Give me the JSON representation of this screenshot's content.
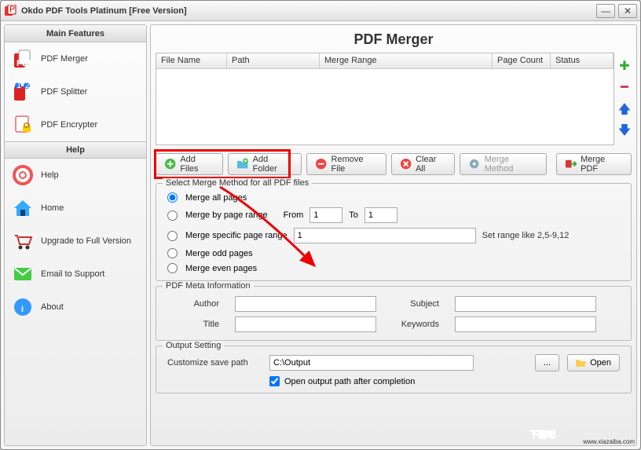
{
  "window": {
    "title": "Okdo PDF Tools Platinum [Free Version]"
  },
  "sidebar": {
    "mainFeaturesHeader": "Main Features",
    "helpHeader": "Help",
    "features": [
      {
        "label": "PDF Merger"
      },
      {
        "label": "PDF Splitter"
      },
      {
        "label": "PDF Encrypter"
      }
    ],
    "helpItems": [
      {
        "label": "Help"
      },
      {
        "label": "Home"
      },
      {
        "label": "Upgrade to Full Version"
      },
      {
        "label": "Email to Support"
      },
      {
        "label": "About"
      }
    ]
  },
  "page": {
    "title": "PDF Merger"
  },
  "fileTable": {
    "columns": [
      "File Name",
      "Path",
      "Merge Range",
      "Page Count",
      "Status"
    ],
    "rows": []
  },
  "toolbar": {
    "addFiles": "Add Files",
    "addFolder": "Add Folder",
    "removeFile": "Remove File",
    "clearAll": "Clear All",
    "mergeMethod": "Merge Method",
    "mergePdf": "Merge PDF"
  },
  "mergeMethod": {
    "title": "Select Merge Method for all PDF files",
    "all": "Merge all pages",
    "byRange": "Merge by page range",
    "fromLabel": "From",
    "toLabel": "To",
    "fromValue": "1",
    "toValue": "1",
    "specific": "Merge specific page range",
    "specificValue": "1",
    "hint": "Set range like 2,5-9,12",
    "odd": "Merge odd pages",
    "even": "Merge even pages"
  },
  "meta": {
    "title": "PDF Meta Information",
    "authorLabel": "Author",
    "authorValue": "",
    "subjectLabel": "Subject",
    "subjectValue": "",
    "titleLabel": "Title",
    "titleValue": "",
    "keywordsLabel": "Keywords",
    "keywordsValue": ""
  },
  "output": {
    "title": "Output Setting",
    "customizeLabel": "Customize save path",
    "pathValue": "C:\\Output",
    "browse": "...",
    "open": "Open",
    "openAfter": "Open output path after completion"
  },
  "watermark": {
    "url": "www.xiazaiba.com"
  }
}
